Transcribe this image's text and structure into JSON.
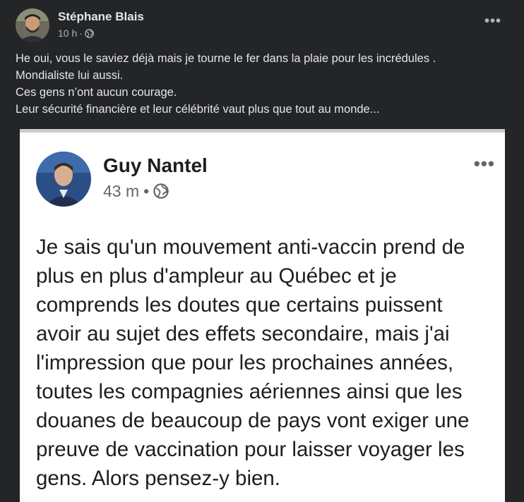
{
  "post": {
    "author": "Stéphane Blais",
    "time": "10 h",
    "separator": "·",
    "privacy_icon": "globe-icon",
    "more_label": "•••",
    "text_lines": [
      "He oui, vous le saviez déjà mais je tourne le fer dans la plaie pour les incrédules .",
      "Mondialiste lui aussi.",
      "Ces gens n’ont aucun courage.",
      "Leur sécurité financière et leur célébrité vaut plus que tout au monde..."
    ]
  },
  "shared_post": {
    "author": "Guy Nantel",
    "time": "43 m",
    "separator": "•",
    "privacy_icon": "globe-icon",
    "more_label": "•••",
    "text_lines": [
      "Je sais qu'un mouvement anti-vaccin prend de",
      "plus en plus d'ampleur au Québec et je",
      "comprends les doutes que certains puissent",
      "avoir au sujet des effets secondaire, mais j'ai",
      "l'impression que pour les prochaines années,",
      "toutes les compagnies aériennes ainsi que les",
      "douanes de beaucoup de pays vont exiger une",
      "preuve de vaccination pour laisser voyager les",
      "gens. Alors pensez-y bien."
    ]
  },
  "colors": {
    "dark_bg": "#242526",
    "dark_text": "#e4e6eb",
    "dark_secondary": "#b0b3b8",
    "card_bg": "#ffffff",
    "card_text": "#1c1e21",
    "card_secondary": "#606770"
  }
}
